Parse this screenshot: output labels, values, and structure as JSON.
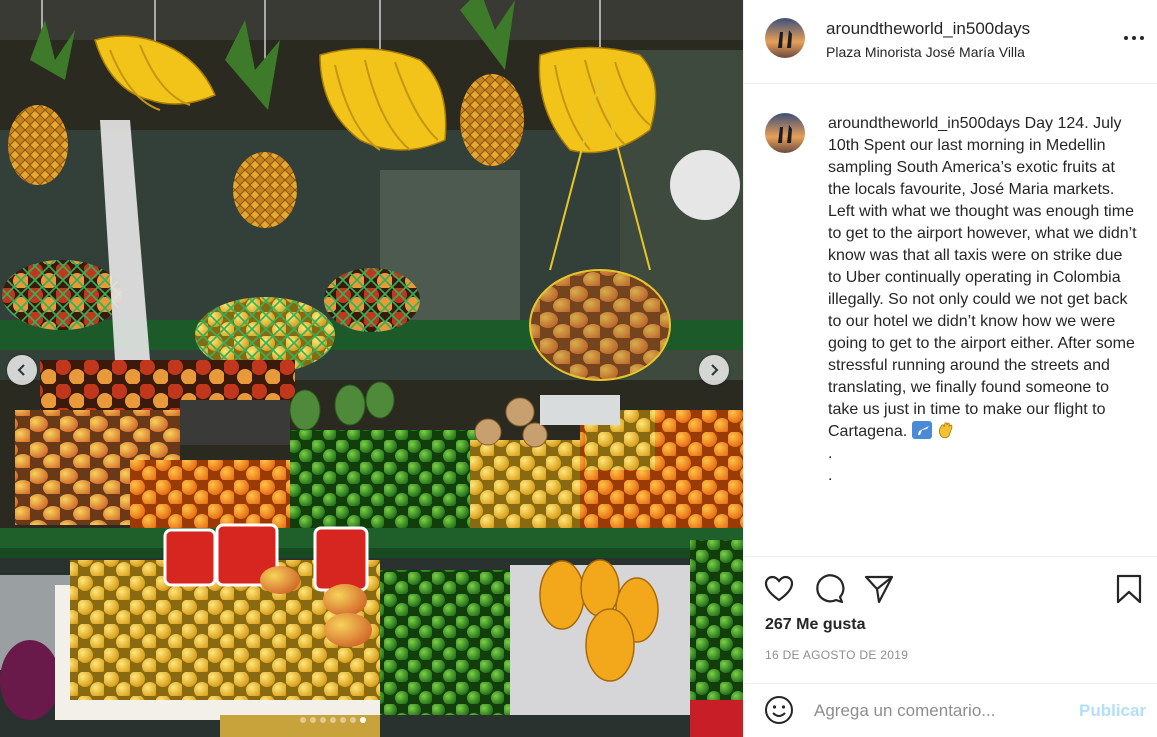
{
  "colors": {
    "accent_disabled": "#b2dffc",
    "text_primary": "#262626",
    "text_secondary": "#8e8e8e",
    "divider": "#efefef"
  },
  "media": {
    "carousel_total_slides": 7,
    "carousel_active_index": 6
  },
  "header": {
    "username": "aroundtheworld_in500days",
    "location": "Plaza Minorista José María Villa"
  },
  "caption": {
    "username": "aroundtheworld_in500days",
    "text": "Day 124. July 10th Spent our last morning in Medellin sampling South America’s exotic fruits at the locals favourite, José Maria markets. Left with what we thought was enough time to get to the airport however, what we didn’t know was that all taxis were on strike due to Uber continually operating in Colombia illegally. So not only could we not get back to our hotel we didn’t know how we were going to get to the airport either. After some stressful running around the streets and translating, we finally found someone to take us just in time to make our flight to Cartagena.",
    "trailing_dots": [
      ".",
      "."
    ],
    "emojis": [
      "airplane-emoji",
      "waving-hand-emoji"
    ]
  },
  "actions": {
    "icons": [
      "heart-icon",
      "comment-icon",
      "share-icon",
      "bookmark-icon"
    ],
    "likes": "267 Me gusta",
    "date": "16 DE AGOSTO DE 2019"
  },
  "comment_box": {
    "placeholder": "Agrega un comentario...",
    "publish_label": "Publicar"
  }
}
